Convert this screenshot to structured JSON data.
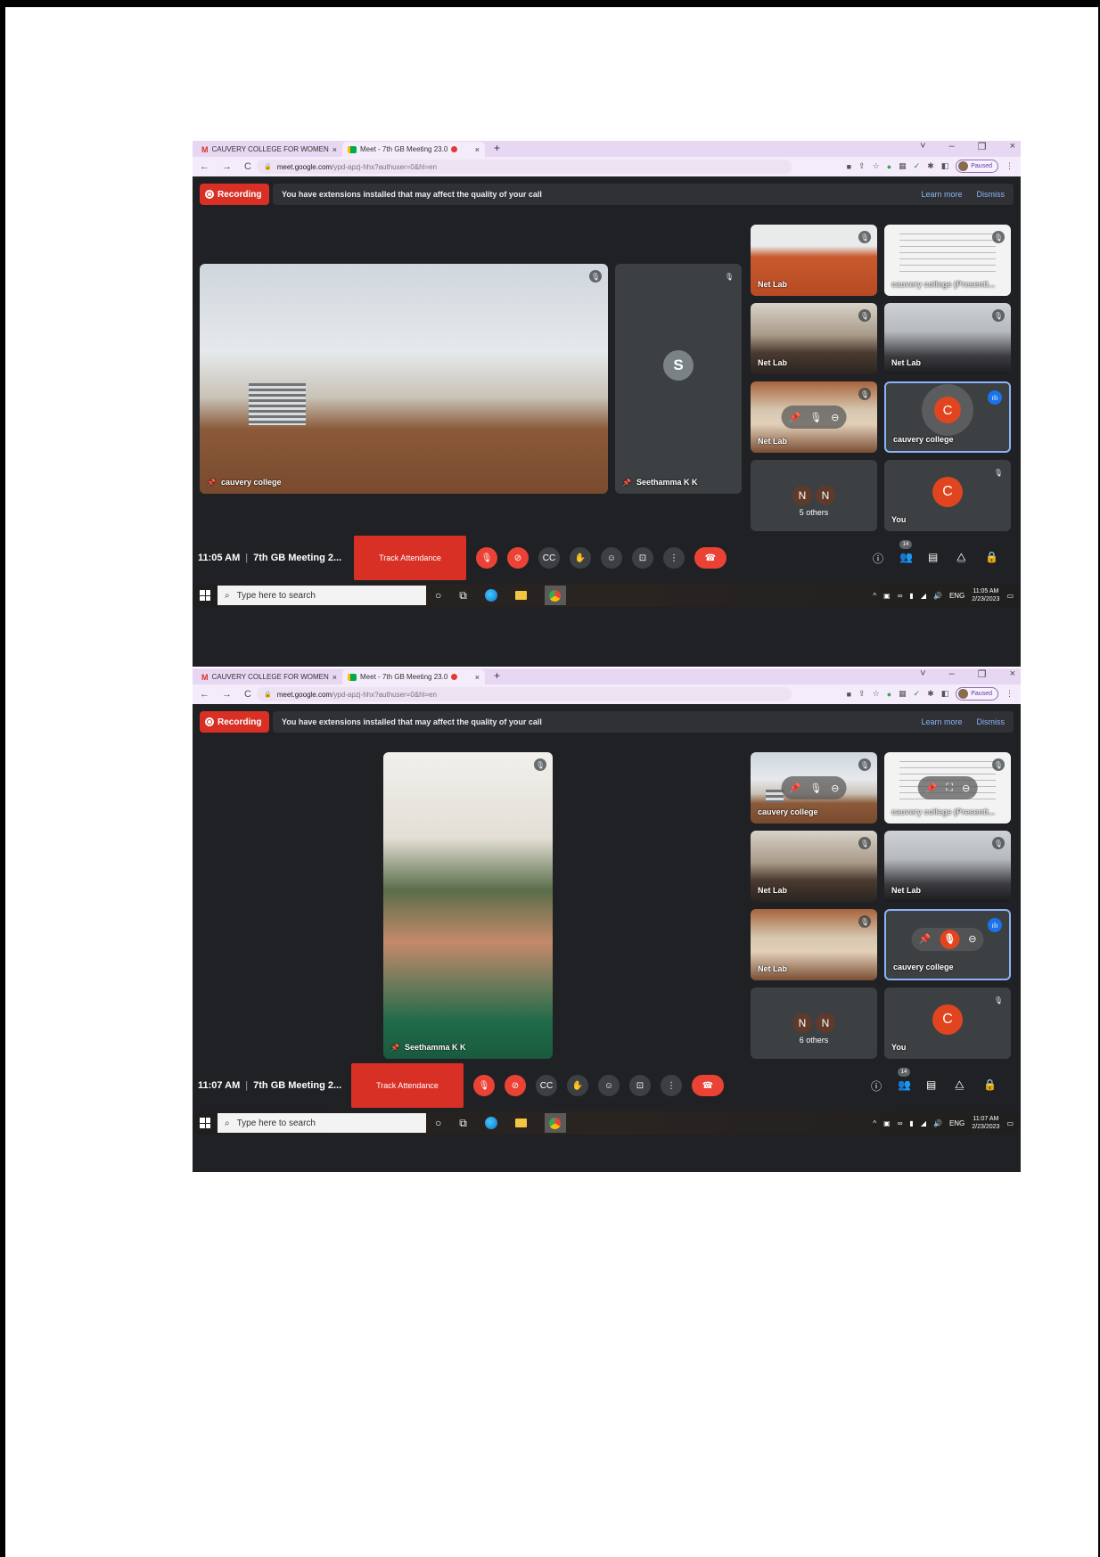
{
  "browser": {
    "tab1_title": "CAUVERY COLLEGE FOR WOMEN",
    "tab1_close": "×",
    "tab2_title": "Meet - 7th GB Meeting 23.0",
    "tab2_close": "×",
    "new_tab": "+",
    "url_host": "meet.google.com",
    "url_path": "/ypd-apzj-hhx?authuser=0&hl=en",
    "profile_status": "Paused",
    "window_controls": [
      "˅",
      "–",
      "❐",
      "×"
    ]
  },
  "meet_banner": {
    "recording_label": "Recording",
    "message": "You have extensions installed that may affect the quality of your call",
    "learn_more": "Learn more",
    "dismiss": "Dismiss"
  },
  "shot1": {
    "main_tile_name": "cauvery college",
    "second_tile_name": "Seethamma K K",
    "second_tile_initial": "S",
    "grid": {
      "t1_name": "Net Lab",
      "t2_name": "cauvery college (Presenti...",
      "t3_name": "Net Lab",
      "t4_name": "Net Lab",
      "t5_name": "Net Lab",
      "t6_name": "cauvery college",
      "t6_initial": "C",
      "t7_initials": [
        "N",
        "N"
      ],
      "t7_label": "5 others",
      "t8_name": "You",
      "t8_initial": "C"
    },
    "clock": "11:05 AM",
    "meeting_name": "7th GB Meeting 2...",
    "track_attendance": "Track Attendance",
    "participant_count": "14",
    "taskbar_search": "Type here to search",
    "tray_lang": "ENG",
    "tray_time": "11:05 AM",
    "tray_date": "2/23/2023"
  },
  "shot2": {
    "main_tile_name": "Seethamma K K",
    "grid": {
      "t1_name": "cauvery college",
      "t2_name": "cauvery college (Presenti...",
      "t3_name": "Net Lab",
      "t4_name": "Net Lab",
      "t5_name": "Net Lab",
      "t6_name": "cauvery college",
      "t7_initials": [
        "N",
        "N"
      ],
      "t7_label": "6 others",
      "t8_name": "You",
      "t8_initial": "C"
    },
    "clock": "11:07 AM",
    "meeting_name": "7th GB Meeting 2...",
    "track_attendance": "Track Attendance",
    "participant_count": "14",
    "taskbar_search": "Type here to search",
    "tray_lang": "ENG",
    "tray_time": "11:07 AM",
    "tray_date": "2/23/2023"
  },
  "colors": {
    "meet_bg": "#202124",
    "recording_red": "#d93025",
    "link_blue": "#8ab4f8",
    "tab_strip": "#e8d7f3"
  },
  "icons": {
    "mic_off": "mic-off-icon",
    "camera_off": "camera-off-icon",
    "captions": "captions-icon",
    "raise_hand": "raise-hand-icon",
    "emoji": "emoji-icon",
    "present": "present-icon",
    "more": "more-options-icon",
    "end_call": "end-call-icon",
    "info": "info-icon",
    "people": "people-icon",
    "chat": "chat-icon",
    "activities": "activities-icon",
    "host_controls": "host-controls-icon"
  }
}
